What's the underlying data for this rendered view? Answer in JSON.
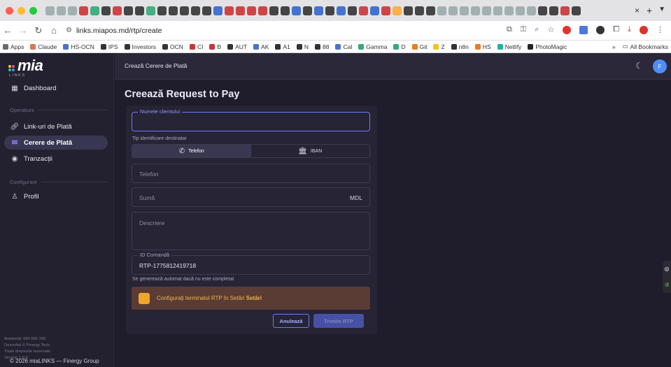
{
  "browser": {
    "traffic_colors": [
      "#ff5f57",
      "#febc2e",
      "#28c840"
    ],
    "tab_icon_colors": [
      "#9aa",
      "#9aa",
      "#9aa",
      "#c33",
      "#3a7",
      "#333",
      "#c33",
      "#333",
      "#333",
      "#3a7",
      "#333",
      "#333",
      "#333",
      "#333",
      "#333",
      "#36c",
      "#c33",
      "#c33",
      "#c33",
      "#c33",
      "#333",
      "#333",
      "#36c",
      "#333",
      "#36c",
      "#333",
      "#36c",
      "#333",
      "#c33",
      "#36c",
      "#c33",
      "#fa3",
      "#333",
      "#333",
      "#333",
      "#9aa",
      "#9aa",
      "#9aa",
      "#9aa",
      "#9aa",
      "#9aa",
      "#9aa",
      "#9aa",
      "#9aa",
      "#333",
      "#333",
      "#c33",
      "#333"
    ],
    "tab_close": "×",
    "tab_new": "+",
    "url": "links.miapos.md/rtp/create",
    "bookmarks": [
      "Apps",
      "Claude",
      "HS-OCN",
      "IPS",
      "Investors",
      "OCN",
      "CI",
      "B",
      "AUT",
      "AK",
      "A1",
      "N",
      "88",
      "Cal",
      "Gamma",
      "D",
      "Git",
      "Z",
      "n8n",
      "HS",
      "Netlify",
      "PhotoMagic"
    ],
    "bookmarks_overflow": "»",
    "all_bookmarks": "All Bookmarks"
  },
  "sidebar": {
    "logo": "mia",
    "logo_sub": "LINKS",
    "dashboard": "Dashboard",
    "section_ops": "Operațiuni",
    "items": [
      "Link-uri de Plată",
      "Cerere de Plată",
      "Tranzacții"
    ],
    "section_config": "Configurare",
    "profile": "Profil",
    "footer": [
      "Asistență: 060 665 335",
      "Dezvoltat © Finergy Tech.",
      "Toate drepturile rezervate.",
      "Versiun 1.0.0"
    ]
  },
  "topbar": {
    "title": "Crează Cerere de Plată",
    "avatar_initial": "F"
  },
  "form": {
    "page_title": "Creează Request to Pay",
    "client_name_label": "Numele clientului",
    "ident_label": "Tip identificare destinatar",
    "toggle_phone": "Telefon",
    "toggle_iban": "IBAN",
    "phone_placeholder": "Telefon",
    "amount_placeholder": "Sumă",
    "currency": "MDL",
    "description_placeholder": "Descriere",
    "order_id_label": "ID Comandă",
    "order_id_value": "RTP-1775812419718",
    "order_hint": "Se generează automat dacă nu este completat",
    "warning_text": "Configurați terminalul RTP în Setări",
    "warning_link": "Setări",
    "cancel_label": "Anulează",
    "send_label": "Trimite RTP"
  },
  "footer": {
    "copyright": "© 2026 miaLINKS — Finergy Group"
  },
  "colors": {
    "accent": "#6a7bff",
    "warning": "#f0a52d",
    "avatar": "#4f8cf7"
  }
}
